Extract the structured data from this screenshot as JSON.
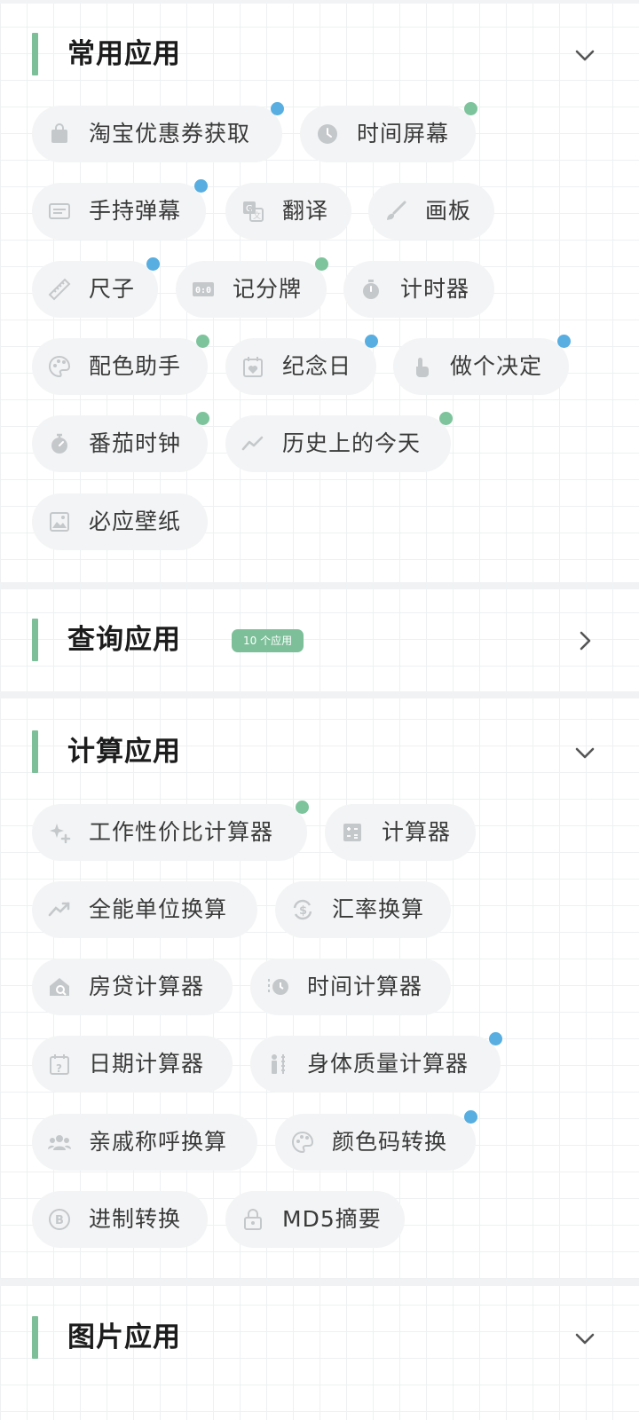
{
  "colors": {
    "accent": "#7dbf99",
    "dot_blue": "#58aee0",
    "dot_green": "#7dc49c",
    "chip_bg": "#f3f4f5"
  },
  "sections": {
    "common": {
      "title": "常用应用",
      "expanded": true,
      "apps": [
        {
          "label": "淘宝优惠券获取",
          "icon": "shopping-bag-icon",
          "dot": "blue"
        },
        {
          "label": "时间屏幕",
          "icon": "clock-icon",
          "dot": "green"
        },
        {
          "label": "手持弹幕",
          "icon": "banner-icon",
          "dot": "blue"
        },
        {
          "label": "翻译",
          "icon": "translate-icon",
          "dot": ""
        },
        {
          "label": "画板",
          "icon": "brush-icon",
          "dot": ""
        },
        {
          "label": "尺子",
          "icon": "ruler-icon",
          "dot": "blue"
        },
        {
          "label": "记分牌",
          "icon": "scoreboard-icon",
          "dot": "green"
        },
        {
          "label": "计时器",
          "icon": "timer-icon",
          "dot": ""
        },
        {
          "label": "配色助手",
          "icon": "palette-icon",
          "dot": "green"
        },
        {
          "label": "纪念日",
          "icon": "calendar-heart-icon",
          "dot": "blue"
        },
        {
          "label": "做个决定",
          "icon": "tap-hand-icon",
          "dot": "blue"
        },
        {
          "label": "番茄时钟",
          "icon": "pomodoro-timer-icon",
          "dot": "green"
        },
        {
          "label": "历史上的今天",
          "icon": "trend-icon",
          "dot": "green"
        },
        {
          "label": "必应壁纸",
          "icon": "image-icon",
          "dot": ""
        }
      ]
    },
    "query": {
      "title": "查询应用",
      "badge": "10 个应用",
      "expanded": false
    },
    "calc": {
      "title": "计算应用",
      "expanded": true,
      "apps": [
        {
          "label": "工作性价比计算器",
          "icon": "sparkle-icon",
          "dot": "green"
        },
        {
          "label": "计算器",
          "icon": "calculator-icon",
          "dot": ""
        },
        {
          "label": "全能单位换算",
          "icon": "conversion-trend-icon",
          "dot": ""
        },
        {
          "label": "汇率换算",
          "icon": "currency-exchange-icon",
          "dot": ""
        },
        {
          "label": "房贷计算器",
          "icon": "house-search-icon",
          "dot": ""
        },
        {
          "label": "时间计算器",
          "icon": "time-history-icon",
          "dot": ""
        },
        {
          "label": "日期计算器",
          "icon": "calendar-question-icon",
          "dot": ""
        },
        {
          "label": "身体质量计算器",
          "icon": "body-height-icon",
          "dot": "blue"
        },
        {
          "label": "亲戚称呼换算",
          "icon": "people-icon",
          "dot": ""
        },
        {
          "label": "颜色码转换",
          "icon": "palette-icon",
          "dot": "blue"
        },
        {
          "label": "进制转换",
          "icon": "bitcoin-circle-icon",
          "dot": ""
        },
        {
          "label": "MD5摘要",
          "icon": "lock-icon",
          "dot": ""
        }
      ]
    },
    "image": {
      "title": "图片应用",
      "expanded": true
    }
  }
}
